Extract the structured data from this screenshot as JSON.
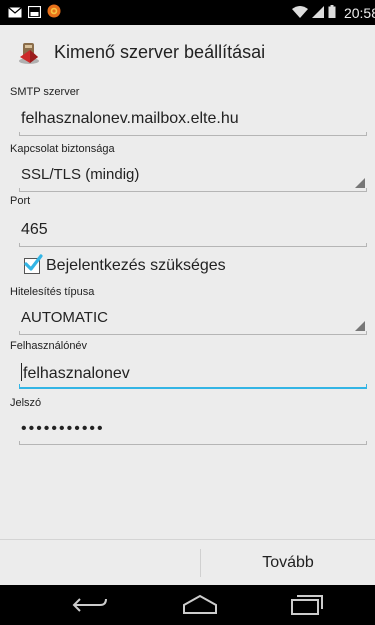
{
  "status_bar": {
    "time": "20:58",
    "icons": [
      "mail-icon",
      "image-icon",
      "app-notification-icon",
      "wifi-icon",
      "signal-icon",
      "battery-icon"
    ]
  },
  "action_bar": {
    "title": "Kimenő szerver beállításai",
    "icon": "outgoing-server-icon"
  },
  "form": {
    "smtp_server": {
      "label": "SMTP szerver",
      "value": "felhasznalonev.mailbox.elte.hu"
    },
    "security": {
      "label": "Kapcsolat biztonsága",
      "value": "SSL/TLS (mindig)"
    },
    "port": {
      "label": "Port",
      "value": "465"
    },
    "login_required": {
      "label": "Bejelentkezés szükséges",
      "checked": true
    },
    "auth_type": {
      "label": "Hitelesítés típusa",
      "value": "AUTOMATIC"
    },
    "username": {
      "label": "Felhasználónév",
      "value": "felhasznalonev"
    },
    "password": {
      "label": "Jelszó",
      "value": "•••••••••••"
    }
  },
  "bottom_bar": {
    "next_label": "Tovább"
  },
  "colors": {
    "focus_accent": "#33b5e5",
    "checkbox_accent": "#33b5e5"
  }
}
